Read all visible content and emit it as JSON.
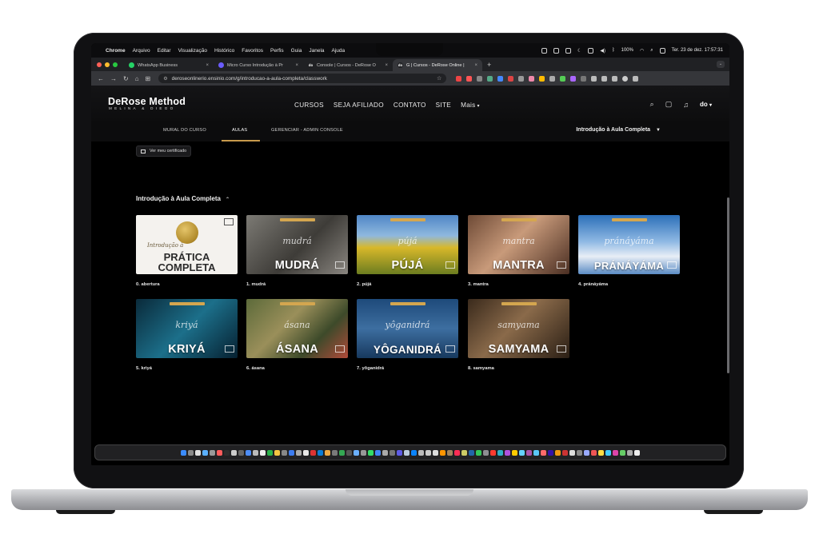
{
  "menubar": {
    "app": "Chrome",
    "items": [
      "Arquivo",
      "Editar",
      "Visualização",
      "Histórico",
      "Favoritos",
      "Perfis",
      "Guia",
      "Janela",
      "Ajuda"
    ],
    "battery": "100%",
    "clock": "Ter. 23 de dez.  17:57:31"
  },
  "browser": {
    "tabs": [
      {
        "label": "WhatsApp Business",
        "fav_color": "#25d366",
        "fav_text": ""
      },
      {
        "label": "Micro Curso Introdução à Pr",
        "fav_color": "#6b5cff",
        "fav_text": ""
      },
      {
        "label": "Console | Cursos - DeRose O",
        "fav_color": "#202124",
        "fav_text": "do"
      },
      {
        "label": "G | Cursos - DeRose Online |",
        "fav_color": "#202124",
        "fav_text": "do"
      }
    ],
    "new_tab": "+",
    "url": "deroseonlinerio.ensinio.com/g/introducao-a-aula-completa/classwork"
  },
  "site": {
    "logo_main": "DeRose Method",
    "logo_sub": "MELINA & DIEGO",
    "nav": [
      "CURSOS",
      "SEJA AFILIADO",
      "CONTATO",
      "SITE"
    ],
    "nav_more": "Mais",
    "avatar": "do",
    "subnav": {
      "mural": "MURAL DO CURSO",
      "aulas": "AULAS",
      "admin": "GERENCIAR - ADMIN CONSOLE"
    },
    "course_selector": "Introdução à Aula Completa",
    "certificate_button": "Ver meu certificado",
    "section_title": "Introdução à Aula Completa"
  },
  "lessons": [
    {
      "caption": "0. abertura",
      "script": "Introdução à",
      "line1": "PRÁTICA",
      "line2": "COMPLETA"
    },
    {
      "caption": "1. mudrá",
      "title": "MUDRÁ",
      "script": "mudrá",
      "bg": "linear-gradient(135deg,#7c7a74,#3e3c38 55%,#8a8680)"
    },
    {
      "caption": "2. pújá",
      "title": "PÚJÁ",
      "script": "pújá",
      "bg": "linear-gradient(180deg,#4f86c6 0%,#8fb8de 35%,#d8b82a 55%,#6c7d20 100%)"
    },
    {
      "caption": "3. mantra",
      "title": "MANTRA",
      "script": "mantra",
      "bg": "linear-gradient(135deg,#6e4a36,#c89a7a 45%,#4a2e22)"
    },
    {
      "caption": "4. pránáyáma",
      "title": "PRÁNÁYÁMA",
      "script": "pránáyáma",
      "bg": "linear-gradient(180deg,#2c6fb8,#8fb9e4 45%,#e8eef6 70%,#5b8cc4)"
    },
    {
      "caption": "5. kriyá",
      "title": "KRIYÁ",
      "script": "kriyá",
      "bg": "linear-gradient(135deg,#0a2a3a,#1c6f8a 50%,#062030)"
    },
    {
      "caption": "6. ásana",
      "title": "ÁSANA",
      "script": "ásana",
      "bg": "linear-gradient(135deg,#5c6a3a,#9a8f5a 40%,#3d4a2a 70%,#b04a3a)"
    },
    {
      "caption": "7. yôganidrá",
      "title": "YÔGANIDRÁ",
      "script": "yôganidrá",
      "bg": "linear-gradient(180deg,#1e4a7a,#3d6ea0 50%,#17395e)"
    },
    {
      "caption": "8. samyama",
      "title": "SAMYAMA",
      "script": "samyama",
      "bg": "linear-gradient(135deg,#3a2a1c,#8a6a4a 45%,#2a1e14)"
    }
  ],
  "icons": {
    "search": "search-icon",
    "cart": "cart-icon",
    "bell": "bell-icon"
  }
}
